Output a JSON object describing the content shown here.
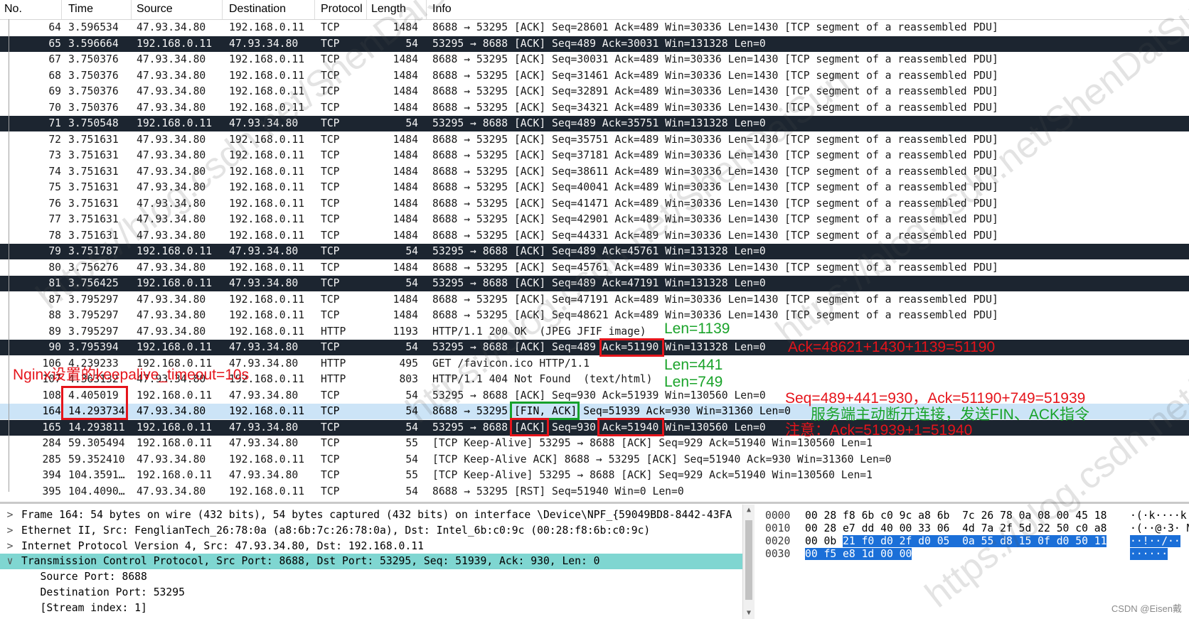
{
  "columns": [
    "No.",
    "Time",
    "Source",
    "Destination",
    "Protocol",
    "Length",
    "Info"
  ],
  "packets": [
    {
      "no": "64",
      "time": "3.596534",
      "src": "47.93.34.80",
      "dst": "192.168.0.11",
      "proto": "TCP",
      "len": "1484",
      "info": "8688 → 53295 [ACK] Seq=28601 Ack=489 Win=30336 Len=1430 [TCP segment of a reassembled PDU]",
      "style": "normal"
    },
    {
      "no": "65",
      "time": "3.596664",
      "src": "192.168.0.11",
      "dst": "47.93.34.80",
      "proto": "TCP",
      "len": "54",
      "info": "53295 → 8688 [ACK] Seq=489 Ack=30031 Win=131328 Len=0",
      "style": "dark"
    },
    {
      "no": "67",
      "time": "3.750376",
      "src": "47.93.34.80",
      "dst": "192.168.0.11",
      "proto": "TCP",
      "len": "1484",
      "info": "8688 → 53295 [ACK] Seq=30031 Ack=489 Win=30336 Len=1430 [TCP segment of a reassembled PDU]",
      "style": "normal"
    },
    {
      "no": "68",
      "time": "3.750376",
      "src": "47.93.34.80",
      "dst": "192.168.0.11",
      "proto": "TCP",
      "len": "1484",
      "info": "8688 → 53295 [ACK] Seq=31461 Ack=489 Win=30336 Len=1430 [TCP segment of a reassembled PDU]",
      "style": "normal"
    },
    {
      "no": "69",
      "time": "3.750376",
      "src": "47.93.34.80",
      "dst": "192.168.0.11",
      "proto": "TCP",
      "len": "1484",
      "info": "8688 → 53295 [ACK] Seq=32891 Ack=489 Win=30336 Len=1430 [TCP segment of a reassembled PDU]",
      "style": "normal"
    },
    {
      "no": "70",
      "time": "3.750376",
      "src": "47.93.34.80",
      "dst": "192.168.0.11",
      "proto": "TCP",
      "len": "1484",
      "info": "8688 → 53295 [ACK] Seq=34321 Ack=489 Win=30336 Len=1430 [TCP segment of a reassembled PDU]",
      "style": "normal"
    },
    {
      "no": "71",
      "time": "3.750548",
      "src": "192.168.0.11",
      "dst": "47.93.34.80",
      "proto": "TCP",
      "len": "54",
      "info": "53295 → 8688 [ACK] Seq=489 Ack=35751 Win=131328 Len=0",
      "style": "dark"
    },
    {
      "no": "72",
      "time": "3.751631",
      "src": "47.93.34.80",
      "dst": "192.168.0.11",
      "proto": "TCP",
      "len": "1484",
      "info": "8688 → 53295 [ACK] Seq=35751 Ack=489 Win=30336 Len=1430 [TCP segment of a reassembled PDU]",
      "style": "normal"
    },
    {
      "no": "73",
      "time": "3.751631",
      "src": "47.93.34.80",
      "dst": "192.168.0.11",
      "proto": "TCP",
      "len": "1484",
      "info": "8688 → 53295 [ACK] Seq=37181 Ack=489 Win=30336 Len=1430 [TCP segment of a reassembled PDU]",
      "style": "normal"
    },
    {
      "no": "74",
      "time": "3.751631",
      "src": "47.93.34.80",
      "dst": "192.168.0.11",
      "proto": "TCP",
      "len": "1484",
      "info": "8688 → 53295 [ACK] Seq=38611 Ack=489 Win=30336 Len=1430 [TCP segment of a reassembled PDU]",
      "style": "normal"
    },
    {
      "no": "75",
      "time": "3.751631",
      "src": "47.93.34.80",
      "dst": "192.168.0.11",
      "proto": "TCP",
      "len": "1484",
      "info": "8688 → 53295 [ACK] Seq=40041 Ack=489 Win=30336 Len=1430 [TCP segment of a reassembled PDU]",
      "style": "normal"
    },
    {
      "no": "76",
      "time": "3.751631",
      "src": "47.93.34.80",
      "dst": "192.168.0.11",
      "proto": "TCP",
      "len": "1484",
      "info": "8688 → 53295 [ACK] Seq=41471 Ack=489 Win=30336 Len=1430 [TCP segment of a reassembled PDU]",
      "style": "normal"
    },
    {
      "no": "77",
      "time": "3.751631",
      "src": "47.93.34.80",
      "dst": "192.168.0.11",
      "proto": "TCP",
      "len": "1484",
      "info": "8688 → 53295 [ACK] Seq=42901 Ack=489 Win=30336 Len=1430 [TCP segment of a reassembled PDU]",
      "style": "normal"
    },
    {
      "no": "78",
      "time": "3.751631",
      "src": "47.93.34.80",
      "dst": "192.168.0.11",
      "proto": "TCP",
      "len": "1484",
      "info": "8688 → 53295 [ACK] Seq=44331 Ack=489 Win=30336 Len=1430 [TCP segment of a reassembled PDU]",
      "style": "normal"
    },
    {
      "no": "79",
      "time": "3.751787",
      "src": "192.168.0.11",
      "dst": "47.93.34.80",
      "proto": "TCP",
      "len": "54",
      "info": "53295 → 8688 [ACK] Seq=489 Ack=45761 Win=131328 Len=0",
      "style": "dark"
    },
    {
      "no": "80",
      "time": "3.756276",
      "src": "47.93.34.80",
      "dst": "192.168.0.11",
      "proto": "TCP",
      "len": "1484",
      "info": "8688 → 53295 [ACK] Seq=45761 Ack=489 Win=30336 Len=1430 [TCP segment of a reassembled PDU]",
      "style": "normal"
    },
    {
      "no": "81",
      "time": "3.756425",
      "src": "192.168.0.11",
      "dst": "47.93.34.80",
      "proto": "TCP",
      "len": "54",
      "info": "53295 → 8688 [ACK] Seq=489 Ack=47191 Win=131328 Len=0",
      "style": "dark"
    },
    {
      "no": "87",
      "time": "3.795297",
      "src": "47.93.34.80",
      "dst": "192.168.0.11",
      "proto": "TCP",
      "len": "1484",
      "info": "8688 → 53295 [ACK] Seq=47191 Ack=489 Win=30336 Len=1430 [TCP segment of a reassembled PDU]",
      "style": "normal"
    },
    {
      "no": "88",
      "time": "3.795297",
      "src": "47.93.34.80",
      "dst": "192.168.0.11",
      "proto": "TCP",
      "len": "1484",
      "info": "8688 → 53295 [ACK] Seq=48621 Ack=489 Win=30336 Len=1430 [TCP segment of a reassembled PDU]",
      "style": "normal"
    },
    {
      "no": "89",
      "time": "3.795297",
      "src": "47.93.34.80",
      "dst": "192.168.0.11",
      "proto": "HTTP",
      "len": "1193",
      "info": "HTTP/1.1 200 OK  (JPEG JFIF image)",
      "style": "normal"
    },
    {
      "no": "90",
      "time": "3.795394",
      "src": "192.168.0.11",
      "dst": "47.93.34.80",
      "proto": "TCP",
      "len": "54",
      "info": "53295 → 8688 [ACK] Seq=489 Ack=51190 Win=131328 Len=0",
      "style": "dark"
    },
    {
      "no": "106",
      "time": "4.239233",
      "src": "192.168.0.11",
      "dst": "47.93.34.80",
      "proto": "HTTP",
      "len": "495",
      "info": "GET /favicon.ico HTTP/1.1",
      "style": "normal"
    },
    {
      "no": "107",
      "time": "4.363132",
      "src": "47.93.34.80",
      "dst": "192.168.0.11",
      "proto": "HTTP",
      "len": "803",
      "info": "HTTP/1.1 404 Not Found  (text/html)",
      "style": "normal"
    },
    {
      "no": "108",
      "time": "4.405019",
      "src": "192.168.0.11",
      "dst": "47.93.34.80",
      "proto": "TCP",
      "len": "54",
      "info": "53295 → 8688 [ACK] Seq=930 Ack=51939 Win=130560 Len=0",
      "style": "normal"
    },
    {
      "no": "164",
      "time": "14.293734",
      "src": "47.93.34.80",
      "dst": "192.168.0.11",
      "proto": "TCP",
      "len": "54",
      "info": "8688 → 53295 [FIN, ACK] Seq=51939 Ack=930 Win=31360 Len=0",
      "style": "sel"
    },
    {
      "no": "165",
      "time": "14.293811",
      "src": "192.168.0.11",
      "dst": "47.93.34.80",
      "proto": "TCP",
      "len": "54",
      "info": "53295 → 8688 [ACK] Seq=930 Ack=51940 Win=130560 Len=0",
      "style": "dark"
    },
    {
      "no": "284",
      "time": "59.305494",
      "src": "192.168.0.11",
      "dst": "47.93.34.80",
      "proto": "TCP",
      "len": "55",
      "info": "[TCP Keep-Alive] 53295 → 8688 [ACK] Seq=929 Ack=51940 Win=130560 Len=1",
      "style": "normal"
    },
    {
      "no": "285",
      "time": "59.352410",
      "src": "47.93.34.80",
      "dst": "192.168.0.11",
      "proto": "TCP",
      "len": "54",
      "info": "[TCP Keep-Alive ACK] 8688 → 53295 [ACK] Seq=51940 Ack=930 Win=31360 Len=0",
      "style": "normal"
    },
    {
      "no": "394",
      "time": "104.3591…",
      "src": "192.168.0.11",
      "dst": "47.93.34.80",
      "proto": "TCP",
      "len": "55",
      "info": "[TCP Keep-Alive] 53295 → 8688 [ACK] Seq=929 Ack=51940 Win=130560 Len=1",
      "style": "normal"
    },
    {
      "no": "395",
      "time": "104.4090…",
      "src": "47.93.34.80",
      "dst": "192.168.0.11",
      "proto": "TCP",
      "len": "54",
      "info": "8688 → 53295 [RST] Seq=51940 Win=0 Len=0",
      "style": "normal"
    }
  ],
  "annotations": {
    "len_1139": "Len=1139",
    "ack_calc": "Ack=48621+1430+1139=51190",
    "nginx_note": "Nginx设置的keepalive_timeout=10s",
    "len_441": "Len=441",
    "len_749": "Len=749",
    "seq_ack_calc": "Seq=489+441=930，Ack=51190+749=51939",
    "server_close": "服务端主动断开连接，发送FIN、ACK指令",
    "note_ack": "注意：Ack=51939+1=51940"
  },
  "details": [
    {
      "arrow": ">",
      "text": "Frame 164: 54 bytes on wire (432 bits), 54 bytes captured (432 bits) on interface \\Device\\NPF_{59049BD8-8442-43FA",
      "selected": false
    },
    {
      "arrow": ">",
      "text": "Ethernet II, Src: FenglianTech_26:78:0a (a8:6b:7c:26:78:0a), Dst: Intel_6b:c0:9c (00:28:f8:6b:c0:9c)",
      "selected": false
    },
    {
      "arrow": ">",
      "text": "Internet Protocol Version 4, Src: 47.93.34.80, Dst: 192.168.0.11",
      "selected": false
    },
    {
      "arrow": "∨",
      "text": "Transmission Control Protocol, Src Port: 8688, Dst Port: 53295, Seq: 51939, Ack: 930, Len: 0",
      "selected": true
    },
    {
      "arrow": "",
      "text": "   Source Port: 8688",
      "selected": false
    },
    {
      "arrow": "",
      "text": "   Destination Port: 53295",
      "selected": false
    },
    {
      "arrow": "",
      "text": "   [Stream index: 1]",
      "selected": false
    }
  ],
  "hex": [
    {
      "offset": "0000",
      "pre": "00 28 f8 6b c0 9c a8 6b  7c 26 78 0a 08 00 45 18",
      "hl": "",
      "ascii_pre": "·(·k····k",
      "ascii_hl": ""
    },
    {
      "offset": "0010",
      "pre": "00 28 e7 dd 40 00 33 06  4d 7a 2f 5d 22 50 c0 a8",
      "hl": "",
      "ascii_pre": "·(··@·3· M",
      "ascii_hl": ""
    },
    {
      "offset": "0020",
      "pre": "00 0b ",
      "hl": "21 f0 d0 2f d0 05  0a 55 d8 15 0f d0 50 11",
      "ascii_pre": "",
      "ascii_hl": "··!··/··"
    },
    {
      "offset": "0030",
      "pre": "",
      "hl": "00 f5 e8 1d 00 00",
      "ascii_pre": "",
      "ascii_hl": "······"
    }
  ],
  "watermark": "https://blog.csdn.net/ShenDaiSun",
  "credit": "CSDN @Eisen戴"
}
